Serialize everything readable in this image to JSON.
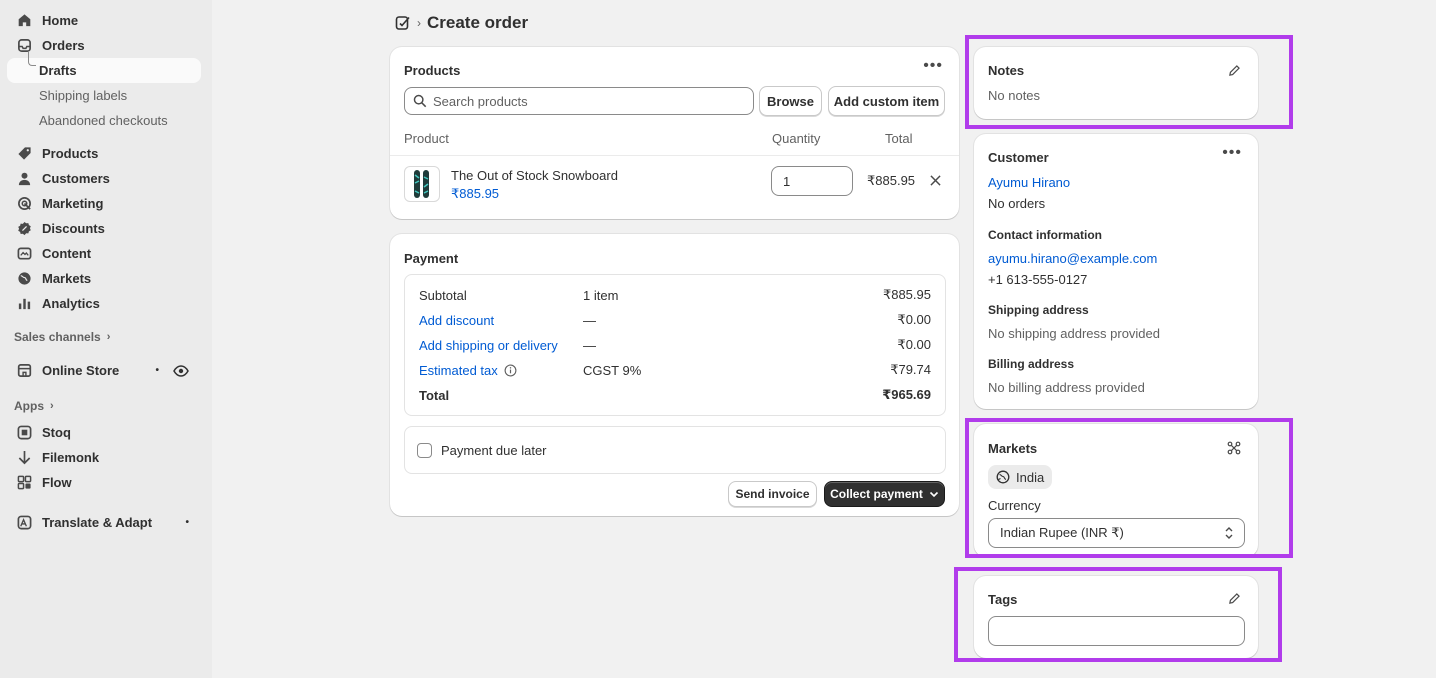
{
  "sidebar": {
    "items": [
      {
        "label": "Home",
        "icon": "home-icon"
      },
      {
        "label": "Orders",
        "icon": "orders-icon"
      },
      {
        "label": "Drafts"
      },
      {
        "label": "Shipping labels"
      },
      {
        "label": "Abandoned checkouts"
      },
      {
        "label": "Products",
        "icon": "tag-icon"
      },
      {
        "label": "Customers",
        "icon": "person-icon"
      },
      {
        "label": "Marketing",
        "icon": "target-icon"
      },
      {
        "label": "Discounts",
        "icon": "discount-icon"
      },
      {
        "label": "Content",
        "icon": "content-icon"
      },
      {
        "label": "Markets",
        "icon": "globe-icon"
      },
      {
        "label": "Analytics",
        "icon": "bar-chart-icon"
      }
    ],
    "sales_channels_label": "Sales channels",
    "online_store": {
      "label": "Online Store",
      "dot": "•"
    },
    "apps_label": "Apps",
    "apps": [
      {
        "label": "Stoq"
      },
      {
        "label": "Filemonk"
      },
      {
        "label": "Flow"
      }
    ],
    "translate": {
      "label": "Translate & Adapt",
      "dot": "•"
    }
  },
  "header": {
    "title": "Create order",
    "separator": "›"
  },
  "products_card": {
    "title": "Products",
    "search_placeholder": "Search products",
    "browse_label": "Browse",
    "custom_item_label": "Add custom item",
    "col_product": "Product",
    "col_quantity": "Quantity",
    "col_total": "Total",
    "line_item": {
      "name": "The Out of Stock Snowboard",
      "price": "₹885.95",
      "quantity": "1",
      "total": "₹885.95"
    }
  },
  "payment_card": {
    "title": "Payment",
    "rows": [
      {
        "label": "Subtotal",
        "detail": "1 item",
        "amount": "₹885.95"
      },
      {
        "label": "Add discount",
        "detail": "—",
        "amount": "₹0.00"
      },
      {
        "label": "Add shipping or delivery",
        "detail": "—",
        "amount": "₹0.00"
      },
      {
        "label": "Estimated tax",
        "detail": "CGST 9%",
        "amount": "₹79.74"
      },
      {
        "label": "Total",
        "detail": "",
        "amount": "₹965.69"
      }
    ],
    "due_later_label": "Payment due later",
    "send_invoice_label": "Send invoice",
    "collect_payment_label": "Collect payment"
  },
  "notes_card": {
    "title": "Notes",
    "value": "No notes"
  },
  "customer_card": {
    "title": "Customer",
    "name": "Ayumu Hirano",
    "orders": "No orders",
    "contact_title": "Contact information",
    "email": "ayumu.hirano@example.com",
    "phone": "+1 613-555-0127",
    "shipping_title": "Shipping address",
    "shipping_value": "No shipping address provided",
    "billing_title": "Billing address",
    "billing_value": "No billing address provided"
  },
  "markets_card": {
    "title": "Markets",
    "market": "India",
    "currency_label": "Currency",
    "currency_value": "Indian Rupee (INR ₹)"
  },
  "tags_card": {
    "title": "Tags",
    "value": ""
  },
  "colors": {
    "link": "#005bd3",
    "highlight": "#b13ceb",
    "dark_button": "#303030"
  }
}
